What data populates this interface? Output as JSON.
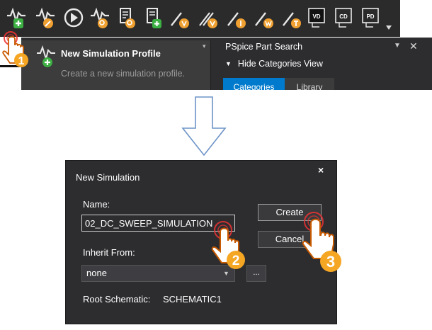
{
  "toolbar": {
    "icons": [
      "new-simulation-profile-icon",
      "edit-simulation-profile-icon",
      "run-icon",
      "view-simulation-results-icon",
      "view-output-file-icon",
      "add-probe-icon",
      "voltage-marker-icon",
      "voltage-differential-marker-icon",
      "current-marker-icon",
      "power-marker-icon",
      "advanced-marker-icon",
      "bias-voltage-display-icon",
      "bias-current-display-icon",
      "bias-power-display-icon"
    ]
  },
  "tooltip": {
    "title": "New Simulation Profile",
    "description": "Create a new simulation profile."
  },
  "part_search": {
    "title": "PSpice Part Search",
    "hide_categories": "Hide Categories View",
    "tabs": [
      "Categories",
      "Library"
    ]
  },
  "dialog": {
    "title": "New Simulation",
    "close_symbol": "×",
    "name_label": "Name:",
    "name_value": "02_DC_SWEEP_SIMULATION",
    "inherit_label": "Inherit From:",
    "inherit_value": "none",
    "ellipsis_label": "...",
    "create_label": "Create",
    "cancel_label": "Cancel",
    "root_label": "Root Schematic:",
    "root_value": "SCHEMATIC1"
  },
  "steps": [
    "1",
    "2",
    "3"
  ],
  "colors": {
    "accent": "#007acc",
    "step_badge": "#f5a623",
    "icon_green": "#3cb043",
    "icon_orange": "#f0a030"
  }
}
